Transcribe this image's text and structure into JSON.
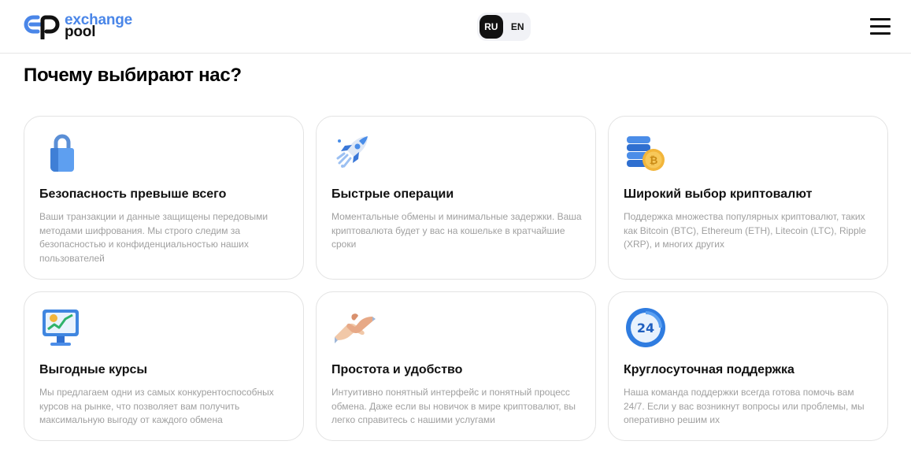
{
  "header": {
    "logo": {
      "line1": "exchange",
      "line2": "pool"
    },
    "languages": [
      {
        "label": "RU",
        "active": true
      },
      {
        "label": "EN",
        "active": false
      }
    ],
    "menu_icon": "hamburger-menu-icon"
  },
  "section": {
    "title": "Почему выбирают нас?",
    "cards": [
      {
        "icon": "padlock-icon",
        "title": "Безопасность превыше всего",
        "description": "Ваши транзакции и данные защищены передовыми методами шифрования. Мы строго следим за безопасностью и конфиденциальностью наших пользователей"
      },
      {
        "icon": "rocket-icon",
        "title": "Быстрые операции",
        "description": "Моментальные обмены и минимальные задержки. Ваша криптовалюта будет у вас на кошельке в кратчайшие сроки"
      },
      {
        "icon": "coins-stack-icon",
        "title": "Широкий выбор криптовалют",
        "description": "Поддержка множества популярных криптовалют, таких как Bitcoin (BTC), Ethereum (ETH), Litecoin (LTC), Ripple (XRP), и многих других"
      },
      {
        "icon": "chart-monitor-icon",
        "title": "Выгодные курсы",
        "description": "Мы предлагаем одни из самых конкурентоспособных курсов на рынке, что позволяет вам получить максимальную выгоду от каждого обмена"
      },
      {
        "icon": "handshake-icon",
        "title": "Простота и удобство",
        "description": "Интуитивно понятный интерфейс и понятный процесс обмена. Даже если вы новичок в мире криптовалют, вы легко справитесь с нашими услугами"
      },
      {
        "icon": "support-24-icon",
        "title": "Круглосуточная поддержка",
        "description": "Наша команда поддержки всегда готова помочь вам 24/7. Если у вас возникнут вопросы или проблемы, мы оперативно решим их",
        "badge": "24"
      }
    ]
  },
  "colors": {
    "brand_blue": "#4a86e8",
    "text_dark": "#111111",
    "text_muted": "#a0a0a0",
    "card_border": "#e3e3e3"
  }
}
